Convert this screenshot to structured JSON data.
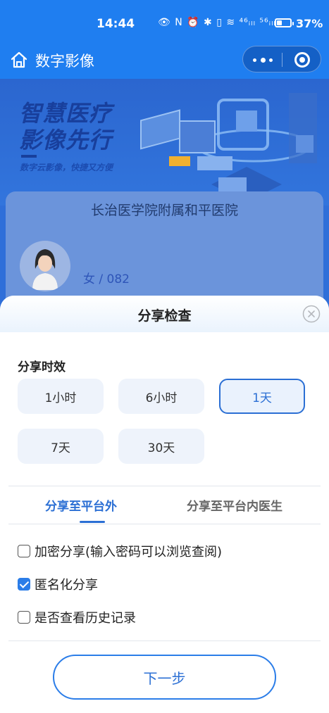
{
  "status_bar": {
    "time": "14:44",
    "icons_text": "👁 N ⏰ ✱ ▯ ≋ ⁴⁶ᵢₗₗ ⁵⁶ᵢₗₗ",
    "battery_percent": 37,
    "battery_text": "37%"
  },
  "nav": {
    "title": "数字影像",
    "home_icon": "home-icon",
    "more_icon": "more-icon",
    "target_icon": "target-icon"
  },
  "banner": {
    "slogan_line1": "智慧医疗",
    "slogan_line2": "影像先行",
    "slogan_sub": "数字云影像，快捷又方便"
  },
  "card": {
    "hospital_name": "长治医学院附属和平医院",
    "patient_info": "女 / 082"
  },
  "sheet": {
    "title": "分享检查",
    "close_icon": "close-icon",
    "duration_label": "分享时效",
    "duration_options": [
      "1小时",
      "6小时",
      "1天",
      "7天",
      "30天"
    ],
    "selected_duration": "1天",
    "tabs": [
      "分享至平台外",
      "分享至平台内医生"
    ],
    "active_tab": "分享至平台外",
    "checkboxes": [
      {
        "label": "加密分享(输入密码可以浏览查阅)",
        "checked": false
      },
      {
        "label": "匿名化分享",
        "checked": true
      },
      {
        "label": "是否查看历史记录",
        "checked": false
      }
    ],
    "next_button": "下一步"
  },
  "colors": {
    "primary": "#2b6fd4",
    "nav_blue": "#1f7ef0",
    "checkbox_blue": "#2b7de8"
  }
}
